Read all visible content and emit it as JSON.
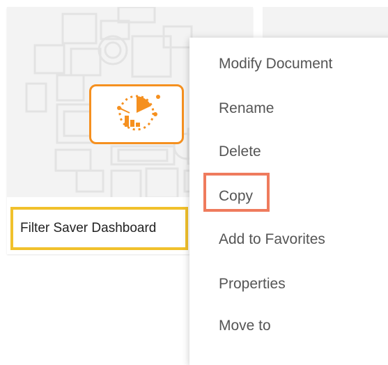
{
  "document": {
    "title": "Filter Saver Dashboard",
    "icon": "dashboard-chart-icon"
  },
  "context_menu": {
    "items": [
      {
        "label": "Modify Document"
      },
      {
        "label": "Rename"
      },
      {
        "label": "Delete"
      },
      {
        "label": "Copy",
        "highlighted": true
      },
      {
        "label": "Add to Favorites"
      },
      {
        "label": "Properties"
      },
      {
        "label": "Move to"
      }
    ]
  },
  "colors": {
    "accent": "#f5901f",
    "title_highlight": "#f1c12c",
    "copy_highlight": "#ef7b5d"
  }
}
